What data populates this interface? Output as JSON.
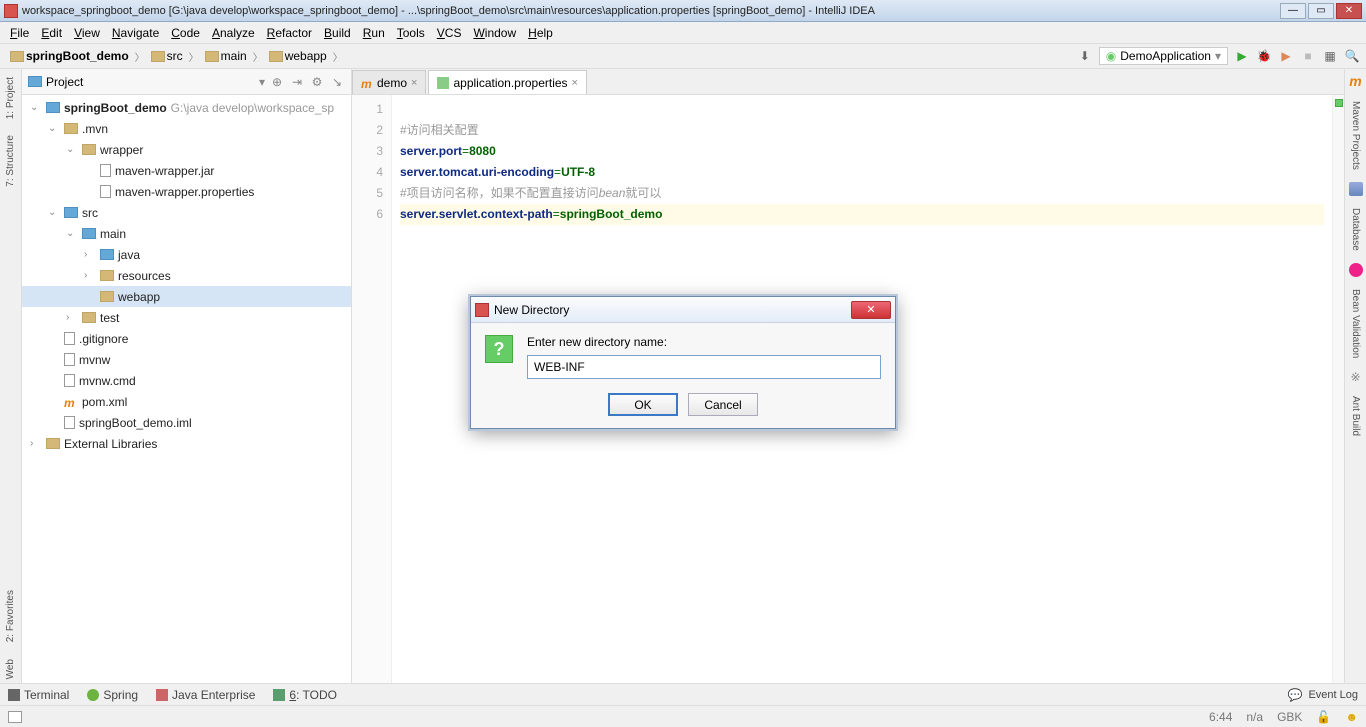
{
  "window": {
    "title": "workspace_springboot_demo [G:\\java develop\\workspace_springboot_demo] - ...\\springBoot_demo\\src\\main\\resources\\application.properties [springBoot_demo] - IntelliJ IDEA"
  },
  "menu": [
    "File",
    "Edit",
    "View",
    "Navigate",
    "Code",
    "Analyze",
    "Refactor",
    "Build",
    "Run",
    "Tools",
    "VCS",
    "Window",
    "Help"
  ],
  "breadcrumbs": [
    {
      "label": "springBoot_demo",
      "bold": true
    },
    {
      "label": "src"
    },
    {
      "label": "main"
    },
    {
      "label": "webapp"
    }
  ],
  "run_config": "DemoApplication",
  "left_tools": [
    "1: Project",
    "7: Structure",
    "2: Favorites",
    "Web"
  ],
  "right_tools": [
    "Maven Projects",
    "Database",
    "Bean Validation",
    "Ant Build"
  ],
  "project_panel": {
    "title": "Project"
  },
  "tree": [
    {
      "pad": 0,
      "toggle": "v",
      "icon": "folder-blue",
      "label": "springBoot_demo",
      "bold": true,
      "hint": "G:\\java develop\\workspace_sp"
    },
    {
      "pad": 1,
      "toggle": "v",
      "icon": "folder",
      "label": ".mvn"
    },
    {
      "pad": 2,
      "toggle": "v",
      "icon": "folder",
      "label": "wrapper"
    },
    {
      "pad": 3,
      "toggle": "",
      "icon": "file",
      "label": "maven-wrapper.jar"
    },
    {
      "pad": 3,
      "toggle": "",
      "icon": "file",
      "label": "maven-wrapper.properties"
    },
    {
      "pad": 1,
      "toggle": "v",
      "icon": "folder-blue",
      "label": "src"
    },
    {
      "pad": 2,
      "toggle": "v",
      "icon": "folder-blue",
      "label": "main"
    },
    {
      "pad": 3,
      "toggle": ">",
      "icon": "folder-blue",
      "label": "java"
    },
    {
      "pad": 3,
      "toggle": ">",
      "icon": "folder",
      "label": "resources"
    },
    {
      "pad": 3,
      "toggle": "",
      "icon": "folder",
      "label": "webapp",
      "selected": true
    },
    {
      "pad": 2,
      "toggle": ">",
      "icon": "folder",
      "label": "test"
    },
    {
      "pad": 1,
      "toggle": "",
      "icon": "file",
      "label": ".gitignore"
    },
    {
      "pad": 1,
      "toggle": "",
      "icon": "file",
      "label": "mvnw"
    },
    {
      "pad": 1,
      "toggle": "",
      "icon": "file",
      "label": "mvnw.cmd"
    },
    {
      "pad": 1,
      "toggle": "",
      "icon": "m",
      "label": "pom.xml"
    },
    {
      "pad": 1,
      "toggle": "",
      "icon": "file",
      "label": "springBoot_demo.iml"
    },
    {
      "pad": 0,
      "toggle": ">",
      "icon": "folder",
      "label": "External Libraries"
    }
  ],
  "tabs": [
    {
      "label": "demo",
      "active": false,
      "icon": "m"
    },
    {
      "label": "application.properties",
      "active": true,
      "icon": "file"
    }
  ],
  "code": {
    "lines": [
      {
        "n": 1,
        "html": ""
      },
      {
        "n": 2,
        "html": "<span class='c-comment'>#访问相关配置</span>"
      },
      {
        "n": 3,
        "html": "<span class='c-key'>server.port</span><span class='c-eq'>=</span><span class='c-val'>8080</span>"
      },
      {
        "n": 4,
        "html": "<span class='c-key'>server.tomcat.uri-encoding</span><span class='c-eq'>=</span><span class='c-val'>UTF-8</span>"
      },
      {
        "n": 5,
        "html": "<span class='c-comment'>#项目访问名称，如果不配置直接访问<em>bean</em>就可以</span>"
      },
      {
        "n": 6,
        "html": "<span class='c-key'>server.servlet.context-path</span><span class='c-eq'>=</span><span class='c-val'>springBoot_demo</span>",
        "cursor": true
      }
    ]
  },
  "bottom_tools": [
    {
      "icon": "term",
      "label": "Terminal"
    },
    {
      "icon": "spring",
      "label": "Spring"
    },
    {
      "icon": "jee",
      "label": "Java Enterprise"
    },
    {
      "icon": "todo",
      "label": "6: TODO",
      "u": "6"
    }
  ],
  "event_log": "Event Log",
  "status": {
    "caret": "6:44",
    "na": "n/a",
    "enc": "GBK"
  },
  "dialog": {
    "title": "New Directory",
    "label": "Enter new directory name:",
    "value": "WEB-INF",
    "ok": "OK",
    "cancel": "Cancel"
  }
}
